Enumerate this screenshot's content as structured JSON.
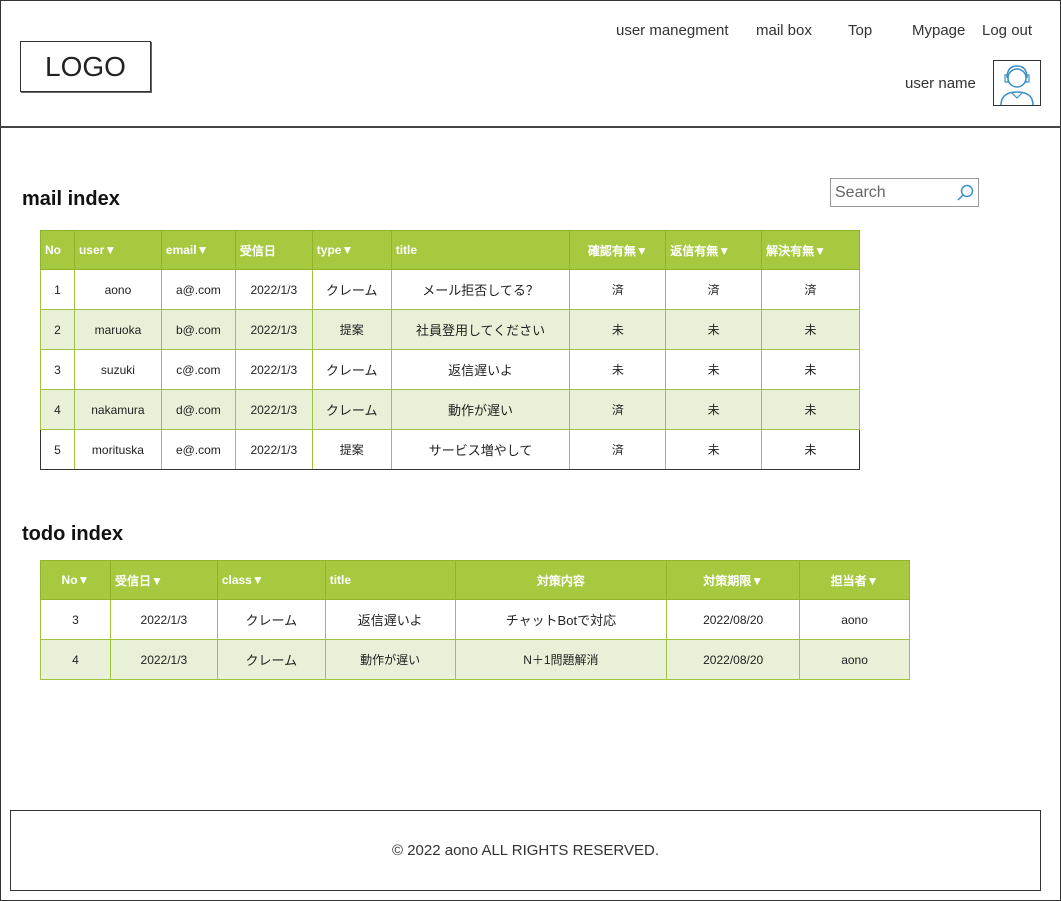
{
  "header": {
    "logo": "LOGO",
    "nav": [
      {
        "label": "user manegment"
      },
      {
        "label": "mail box"
      },
      {
        "label": "Top"
      },
      {
        "label": "Mypage"
      },
      {
        "label": "Log out"
      }
    ],
    "user_name": "user name",
    "avatar_icon": "user-avatar-icon"
  },
  "mail_index": {
    "title": "mail index",
    "search_placeholder": "Search",
    "columns": [
      "No",
      "user▼",
      "email▼",
      "受信日",
      "type▼",
      "title",
      "確認有無▼",
      "返信有無▼",
      "解決有無▼"
    ],
    "rows": [
      [
        "1",
        "aono",
        "a@.com",
        "2022/1/3",
        "クレーム",
        "メール拒否してる？",
        "済",
        "済",
        "済"
      ],
      [
        "2",
        "maruoka",
        "b@.com",
        "2022/1/3",
        "提案",
        "社員登用してください",
        "未",
        "未",
        "未"
      ],
      [
        "3",
        "suzuki",
        "c@.com",
        "2022/1/3",
        "クレーム",
        "返信遅いよ",
        "未",
        "未",
        "未"
      ],
      [
        "4",
        "nakamura",
        "d@.com",
        "2022/1/3",
        "クレーム",
        "動作が遅い",
        "済",
        "未",
        "未"
      ],
      [
        "5",
        "morituska",
        "e@.com",
        "2022/1/3",
        "提案",
        "サービス増やして",
        "済",
        "未",
        "未"
      ]
    ]
  },
  "todo_index": {
    "title": "todo index",
    "columns": [
      "No▼",
      "受信日▼",
      "class▼",
      "title",
      "対策内容",
      "対策期限▼",
      "担当者▼"
    ],
    "rows": [
      [
        "3",
        "2022/1/3",
        "クレーム",
        "返信遅いよ",
        "チャットBotで対応",
        "2022/08/20",
        "aono"
      ],
      [
        "4",
        "2022/1/3",
        "クレーム",
        "動作が遅い",
        "N＋1問題解消",
        "2022/08/20",
        "aono"
      ]
    ]
  },
  "footer": {
    "copyright": "© 2022 aono ALL RIGHTS RESERVED."
  },
  "colors": {
    "header_bg": "#a6c940",
    "alt_row_bg": "#e8f0d8",
    "border": "#9fc33f"
  }
}
